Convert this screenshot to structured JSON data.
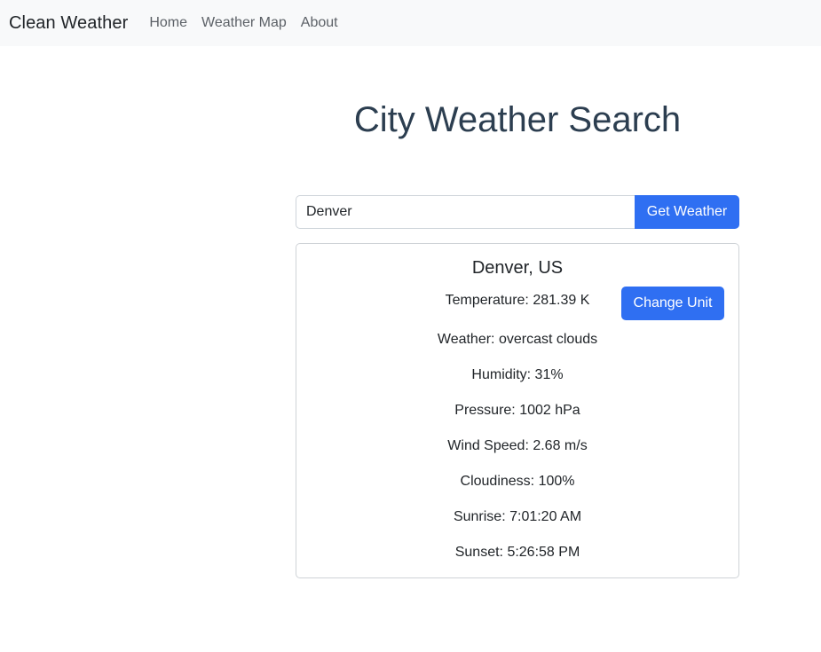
{
  "navbar": {
    "brand": "Clean Weather",
    "links": [
      "Home",
      "Weather Map",
      "About"
    ]
  },
  "page": {
    "title": "City Weather Search"
  },
  "search": {
    "value": "Denver",
    "button_label": "Get Weather"
  },
  "weather": {
    "city": "Denver, US",
    "temperature": "Temperature: 281.39 K",
    "change_unit_label": "Change Unit",
    "description": "Weather: overcast clouds",
    "humidity": "Humidity: 31%",
    "pressure": "Pressure: 1002 hPa",
    "wind_speed": "Wind Speed: 2.68 m/s",
    "cloudiness": "Cloudiness: 100%",
    "sunrise": "Sunrise: 7:01:20 AM",
    "sunset": "Sunset: 5:26:58 PM"
  },
  "colors": {
    "primary": "#2f6ff2",
    "navbar_bg": "#f8f9fa",
    "title": "#2c3e50"
  }
}
